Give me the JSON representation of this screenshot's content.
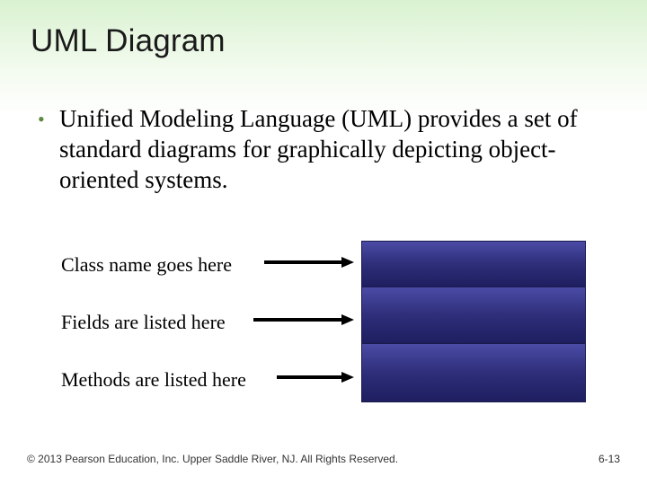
{
  "title": "UML Diagram",
  "bullet": "Unified Modeling Language (UML) provides a set of standard diagrams for graphically depicting object-oriented systems.",
  "labels": {
    "class_name": "Class name goes here",
    "fields": "Fields are listed here",
    "methods": "Methods are listed here"
  },
  "footer": {
    "copyright": "© 2013 Pearson Education, Inc. Upper Saddle River, NJ. All Rights Reserved.",
    "page": "6-13"
  }
}
